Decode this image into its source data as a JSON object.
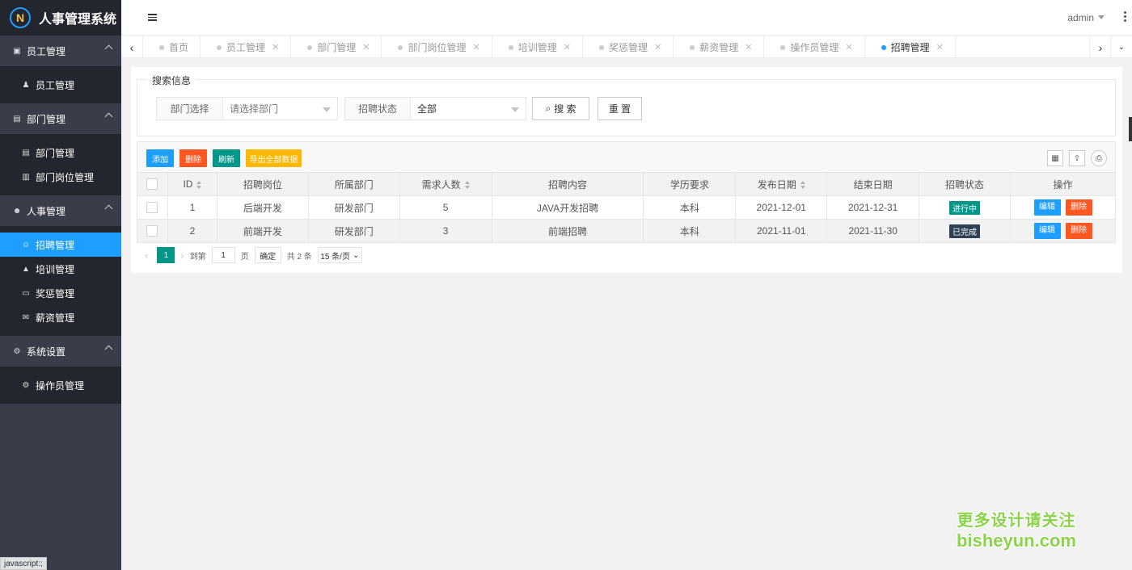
{
  "app": {
    "title": "人事管理系统",
    "logo_mark": "N"
  },
  "sidebar": {
    "groups": [
      {
        "label": "员工管理",
        "items": [
          {
            "label": "员工管理"
          }
        ]
      },
      {
        "label": "部门管理",
        "items": [
          {
            "label": "部门管理"
          },
          {
            "label": "部门岗位管理"
          }
        ]
      },
      {
        "label": "人事管理",
        "items": [
          {
            "label": "招聘管理"
          },
          {
            "label": "培训管理"
          },
          {
            "label": "奖惩管理"
          },
          {
            "label": "薪资管理"
          }
        ]
      },
      {
        "label": "系统设置",
        "items": [
          {
            "label": "操作员管理"
          }
        ]
      }
    ]
  },
  "header": {
    "user": "admin"
  },
  "tabs": [
    {
      "label": "首页"
    },
    {
      "label": "员工管理"
    },
    {
      "label": "部门管理"
    },
    {
      "label": "部门岗位管理"
    },
    {
      "label": "培训管理"
    },
    {
      "label": "奖惩管理"
    },
    {
      "label": "薪资管理"
    },
    {
      "label": "操作员管理"
    },
    {
      "label": "招聘管理"
    }
  ],
  "search": {
    "legend": "搜索信息",
    "dept_label": "部门选择",
    "dept_placeholder": "请选择部门",
    "status_label": "招聘状态",
    "status_value": "全部",
    "search_btn": "搜 索",
    "reset_btn": "重 置"
  },
  "toolbar": {
    "add": "添加",
    "delete": "删除",
    "refresh": "刷新",
    "export": "导出全部数据"
  },
  "table": {
    "headers": [
      "ID",
      "招聘岗位",
      "所属部门",
      "需求人数",
      "招聘内容",
      "学历要求",
      "发布日期",
      "结束日期",
      "招聘状态",
      "操作"
    ],
    "rows": [
      {
        "id": "1",
        "position": "后端开发",
        "dept": "研发部门",
        "count": "5",
        "content": "JAVA开发招聘",
        "edu": "本科",
        "start": "2021-12-01",
        "end": "2021-12-31",
        "status": "进行中",
        "edit": "编辑",
        "del": "删除"
      },
      {
        "id": "2",
        "position": "前端开发",
        "dept": "研发部门",
        "count": "3",
        "content": "前端招聘",
        "edu": "本科",
        "start": "2021-11-01",
        "end": "2021-11-30",
        "status": "已完成",
        "edit": "编辑",
        "del": "删除"
      }
    ]
  },
  "pager": {
    "current": "1",
    "goto": "到第",
    "page_input": "1",
    "page_unit": "页",
    "confirm": "确定",
    "total": "共 2 条",
    "per_page": "15 条/页"
  },
  "statusbar": {
    "text": "javascript:;"
  },
  "watermark": {
    "line1": "更多设计请关注",
    "line2": "bisheyun.com"
  }
}
